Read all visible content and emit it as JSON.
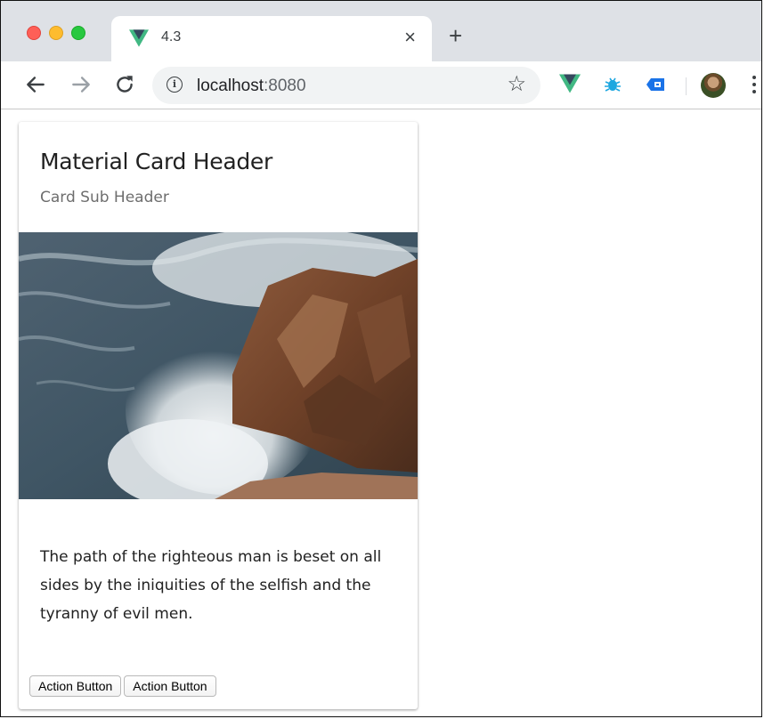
{
  "browser": {
    "tab": {
      "title": "4.3",
      "close_glyph": "×"
    },
    "new_tab_glyph": "+",
    "address": {
      "host": "localhost",
      "port": ":8080"
    },
    "icons": {
      "favicon": "vue-logo-icon",
      "back": "back-arrow-icon",
      "forward": "forward-arrow-icon",
      "reload": "reload-icon",
      "info": "info-icon",
      "bookmark": "star-icon",
      "extensions": [
        "vue-devtools-icon",
        "bug-icon",
        "screen-cast-icon"
      ],
      "profile": "avatar",
      "menu": "more-vert-icon"
    },
    "colors": {
      "vue_green": "#41b883",
      "vue_dark": "#35495e",
      "ext_blue": "#1a73e8",
      "ext_cyan": "#1ea7e0"
    }
  },
  "card": {
    "title": "Material Card Header",
    "subtitle": "Card Sub Header",
    "image": "ocean-waves-crashing-on-rocks",
    "text": "The path of the righteous man is beset on all sides by the iniquities of the selfish and the tyranny of evil men.",
    "actions": [
      {
        "label": "Action Button"
      },
      {
        "label": "Action Button"
      }
    ]
  }
}
